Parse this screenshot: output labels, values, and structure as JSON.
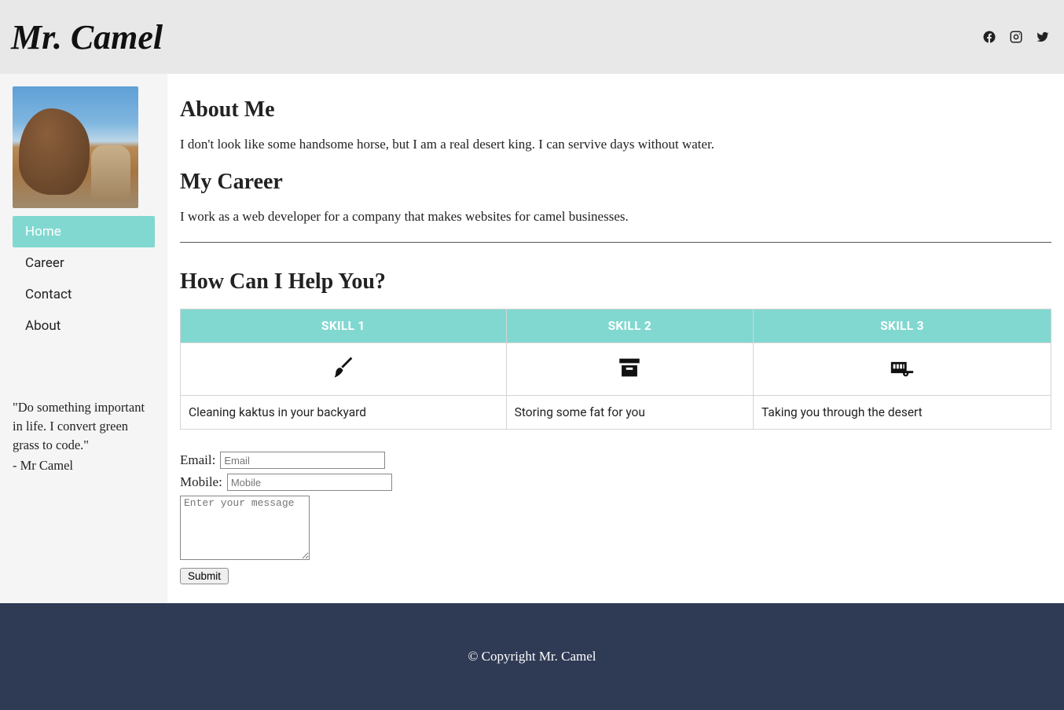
{
  "header": {
    "brand": "Mr. Camel",
    "social_icons": [
      "facebook-icon",
      "instagram-icon",
      "twitter-icon"
    ]
  },
  "sidebar": {
    "image_alt": "camel",
    "nav": [
      {
        "label": "Home",
        "active": true
      },
      {
        "label": "Career",
        "active": false
      },
      {
        "label": "Contact",
        "active": false
      },
      {
        "label": "About",
        "active": false
      }
    ],
    "quote": "\"Do something important in life. I convert green grass to code.\"",
    "quote_author": "- Mr Camel"
  },
  "main": {
    "about_heading": "About Me",
    "about_text": "I don't look like some handsome horse, but I am a real desert king. I can servive days without water.",
    "career_heading": "My Career",
    "career_text": "I work as a web developer for a company that makes websites for camel businesses.",
    "help_heading": "How Can I Help You?",
    "table": {
      "headers": [
        "SKILL 1",
        "SKILL 2",
        "SKILL 3"
      ],
      "icons": [
        "broom-icon",
        "archive-icon",
        "trailer-icon"
      ],
      "descs": [
        "Cleaning kaktus in your backyard",
        "Storing some fat for you",
        "Taking you through the desert"
      ]
    },
    "form": {
      "email_label": "Email:",
      "email_placeholder": "Email",
      "mobile_label": "Mobile:",
      "mobile_placeholder": "Mobile",
      "message_placeholder": "Enter your message",
      "submit_label": "Submit"
    }
  },
  "footer": {
    "text": "© Copyright Mr. Camel"
  },
  "colors": {
    "accent": "#81d8d0",
    "header_bg": "#e8e8e8",
    "footer_bg": "#2f3a55"
  }
}
